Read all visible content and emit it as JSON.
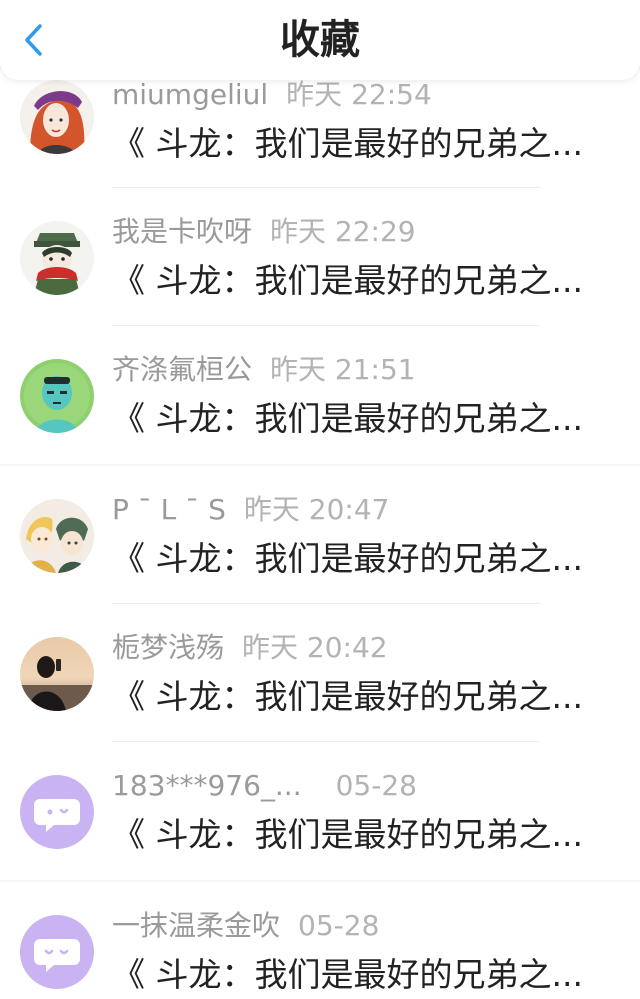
{
  "header": {
    "title": "收藏",
    "back_icon": "chevron-left-icon",
    "accent": "#2e9bf0"
  },
  "items": [
    {
      "user": "miumgeliul",
      "time": "昨天 22:54",
      "text": "《 斗龙：我们是最好的兄弟之...",
      "avatar": "girl-red-hair-avatar"
    },
    {
      "user": "我是卡吹呀",
      "time": "昨天 22:29",
      "text": "《 斗龙：我们是最好的兄弟之...",
      "avatar": "boy-red-scarf-avatar"
    },
    {
      "user": "齐涤氟桓公",
      "time": "昨天 21:51",
      "text": "《 斗龙：我们是最好的兄弟之...",
      "avatar": "green-face-avatar"
    },
    {
      "user": "P ˉ L ˉ S",
      "time": "昨天 20:47",
      "text": "《 斗龙：我们是最好的兄弟之...",
      "avatar": "anime-duo-avatar"
    },
    {
      "user": "栀梦浅殇",
      "time": "昨天 20:42",
      "text": "《 斗龙：我们是最好的兄弟之...",
      "avatar": "sunset-photo-avatar"
    },
    {
      "user": "183***976_...",
      "time": "05-28",
      "text": "《 斗龙：我们是最好的兄弟之...",
      "avatar": "default-purple-avatar"
    },
    {
      "user": "一抹温柔金吹",
      "time": "05-28",
      "text": "《 斗龙：我们是最好的兄弟之...",
      "avatar": "default-purple-avatar"
    }
  ]
}
